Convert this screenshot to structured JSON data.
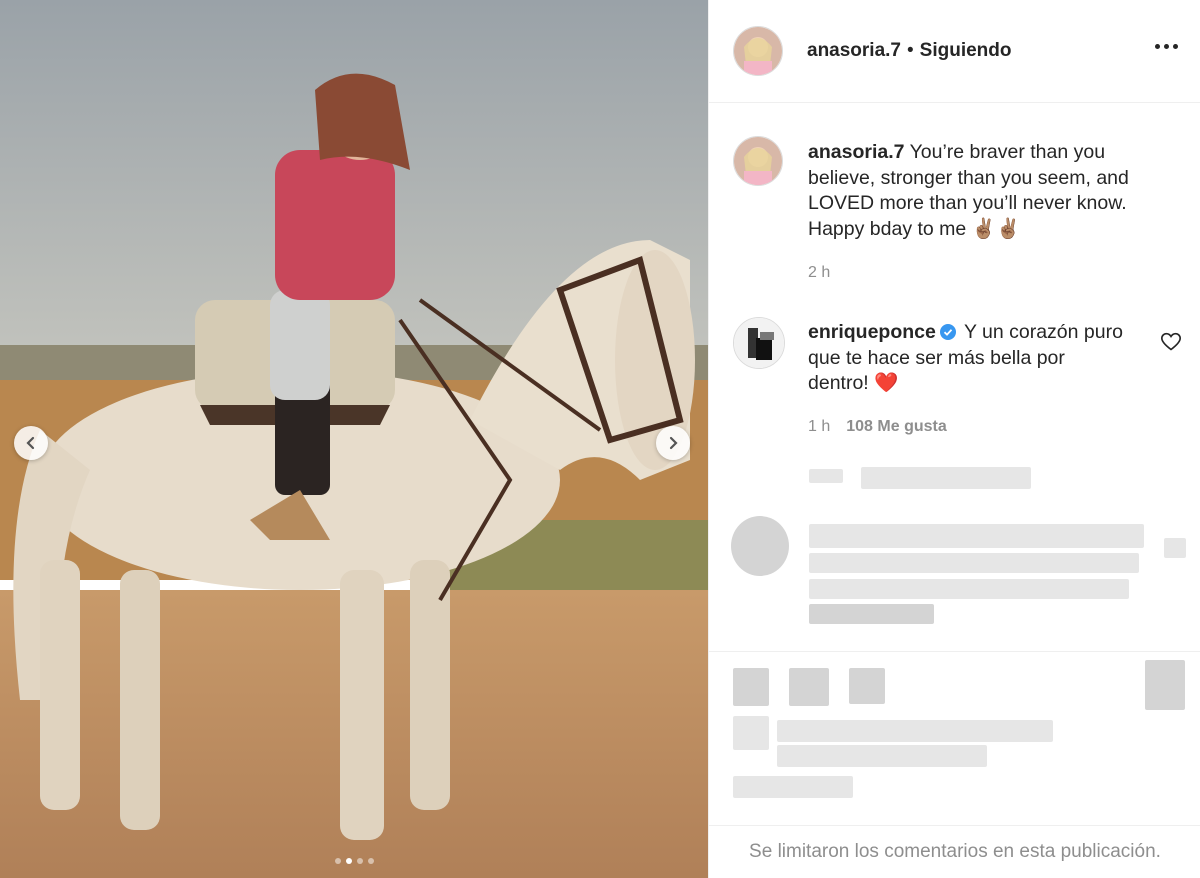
{
  "post": {
    "author": "anasoria.7",
    "separator": "•",
    "follow_status": "Siguiendo"
  },
  "caption": {
    "username": "anasoria.7",
    "text": "You’re braver than you believe, stronger than you seem, and LOVED more than you’ll never know. Happy bday to me ✌🏽✌🏽",
    "time": "2 h"
  },
  "comment": {
    "username": "enriqueponce",
    "text": "Y un corazón puro que te hace ser más bella por dentro!",
    "heart": "❤️",
    "time": "1 h",
    "likes": "108 Me gusta"
  },
  "carousel": {
    "slide_count": 4,
    "active_index": 1
  },
  "footer": {
    "comments_limited": "Se limitaron los comentarios en esta publicación."
  },
  "colors": {
    "text": "#262626",
    "muted": "#8e8e8e",
    "verified": "#3897f0",
    "border": "#efefef"
  },
  "icons": [
    "chevron-left-icon",
    "chevron-right-icon",
    "more-icon",
    "verified-icon",
    "heart-outline-icon"
  ]
}
